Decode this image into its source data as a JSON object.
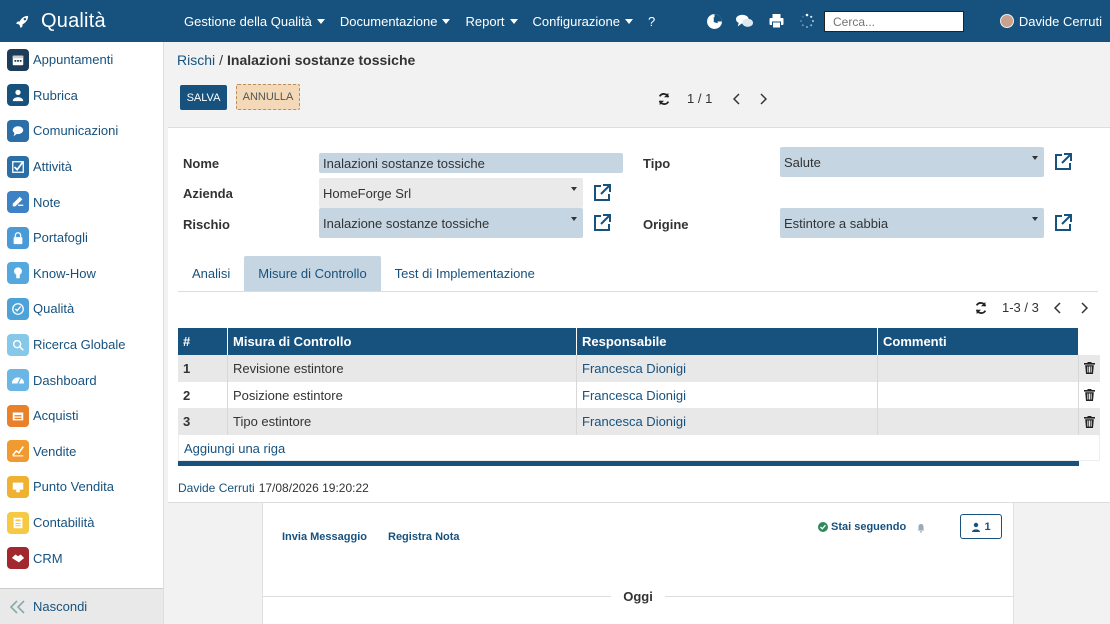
{
  "app": {
    "title": "Qualità",
    "menu": [
      "Gestione della Qualità",
      "Documentazione",
      "Report",
      "Configurazione"
    ],
    "help": "?",
    "search_placeholder": "Cerca...",
    "user": "Davide Cerruti"
  },
  "sidebar": {
    "items": [
      {
        "label": "Appuntamenti",
        "icon": "calendar-icon",
        "color": "#1c3c5a"
      },
      {
        "label": "Rubrica",
        "icon": "contacts-icon",
        "color": "#17527e"
      },
      {
        "label": "Comunicazioni",
        "icon": "chat-icon",
        "color": "#2a6fa8"
      },
      {
        "label": "Attività",
        "icon": "checkbox-icon",
        "color": "#2a6fa8"
      },
      {
        "label": "Note",
        "icon": "note-icon",
        "color": "#3d82c4"
      },
      {
        "label": "Portafogli",
        "icon": "lock-icon",
        "color": "#4a9ad8"
      },
      {
        "label": "Know-How",
        "icon": "lightbulb-icon",
        "color": "#55a8de"
      },
      {
        "label": "Qualità",
        "icon": "quality-icon",
        "color": "#4da3d8"
      },
      {
        "label": "Ricerca Globale",
        "icon": "search-icon",
        "color": "#86c8ea"
      },
      {
        "label": "Dashboard",
        "icon": "dashboard-icon",
        "color": "#6ab6e4"
      },
      {
        "label": "Acquisti",
        "icon": "purchase-icon",
        "color": "#e8812a"
      },
      {
        "label": "Vendite",
        "icon": "sales-icon",
        "color": "#f09a30"
      },
      {
        "label": "Punto Vendita",
        "icon": "pos-icon",
        "color": "#f0b030"
      },
      {
        "label": "Contabilità",
        "icon": "accounting-icon",
        "color": "#f6c945"
      },
      {
        "label": "CRM",
        "icon": "handshake-icon",
        "color": "#a0282e"
      }
    ],
    "footer": "Nascondi"
  },
  "breadcrumb": {
    "parent": "Rischi",
    "separator": "/",
    "current": "Inalazioni sostanze tossiche"
  },
  "toolbar": {
    "save": "SALVA",
    "cancel": "ANNULLA",
    "pager": "1 / 1"
  },
  "form": {
    "nome_label": "Nome",
    "nome_value": "Inalazioni sostanze tossiche",
    "azienda_label": "Azienda",
    "azienda_value": "HomeForge Srl",
    "rischio_label": "Rischio",
    "rischio_value": "Inalazione sostanze tossiche",
    "tipo_label": "Tipo",
    "tipo_value": "Salute",
    "origine_label": "Origine",
    "origine_value": "Estintore a sabbia"
  },
  "tabs": [
    "Analisi",
    "Misure di Controllo",
    "Test di Implementazione"
  ],
  "list": {
    "pager": "1-3 / 3",
    "columns": [
      "#",
      "Misura di Controllo",
      "Responsabile",
      "Commenti"
    ],
    "rows": [
      {
        "n": "1",
        "measure": "Revisione estintore",
        "owner": "Francesca Dionigi",
        "comments": ""
      },
      {
        "n": "2",
        "measure": "Posizione estintore",
        "owner": "Francesca Dionigi",
        "comments": ""
      },
      {
        "n": "3",
        "measure": "Tipo estintore",
        "owner": "Francesca Dionigi",
        "comments": ""
      }
    ],
    "add_row": "Aggiungi una riga"
  },
  "meta": {
    "author": "Davide Cerruti",
    "timestamp": "17/08/2026 19:20:22"
  },
  "chatter": {
    "send_message": "Invia Messaggio",
    "log_note": "Registra Nota",
    "following": "Stai seguendo",
    "followers": "1",
    "today": "Oggi"
  },
  "colors": {
    "primary": "#17527e",
    "field_bg": "#c5d6e2",
    "cancel_bg": "#f4d9b9"
  }
}
